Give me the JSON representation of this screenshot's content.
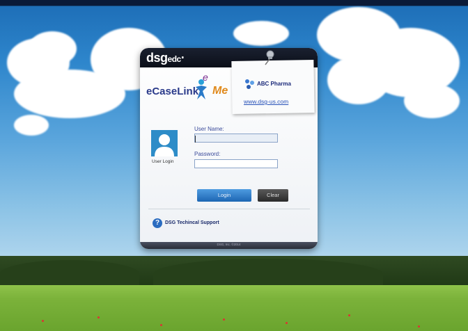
{
  "header": {
    "brand": "dsg",
    "brand_sub": "edc",
    "brand_mark": "·"
  },
  "product": {
    "name": "eCaseLink",
    "me_e": "e",
    "me_me": "Me"
  },
  "sponsor_note": {
    "company": "ABC Pharma",
    "url": "www.dsg-us.com"
  },
  "login": {
    "avatar_label": "User Login",
    "username_label": "User Name:",
    "username_value": "",
    "password_label": "Password:",
    "password_value": "",
    "login_button": "Login",
    "clear_button": "Clear"
  },
  "support": {
    "label": "DSG Techincal Support",
    "icon": "help-icon"
  },
  "footer": {
    "copyright": "DSG, Inc. ©2014"
  },
  "colors": {
    "header": "#0b0f18",
    "login_btn": "#1d66b3",
    "clear_btn": "#2a2a2a",
    "accent_blue": "#2d8cc8"
  }
}
